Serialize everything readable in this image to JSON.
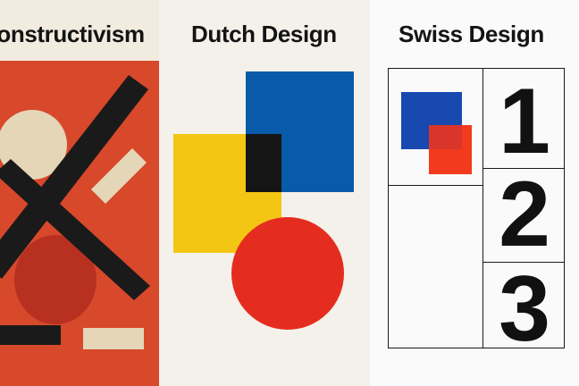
{
  "panels": [
    {
      "title": "Constructivism",
      "background": "#f2ebdf",
      "poster_color": "#d8482b"
    },
    {
      "title": "Dutch Design",
      "background": "#f4f1ea"
    },
    {
      "title": "Swiss Design",
      "background": "#fafafa",
      "numbers": [
        "1",
        "2",
        "3"
      ]
    }
  ],
  "colors": {
    "black": "#1a1a1a",
    "cream": "#e5d6b8",
    "dark_red": "#b83120",
    "yellow": "#f3c614",
    "blue": "#0a5aaa",
    "red": "#e52d1f",
    "swiss_blue": "#1849b0",
    "swiss_red": "#f23a1e"
  }
}
